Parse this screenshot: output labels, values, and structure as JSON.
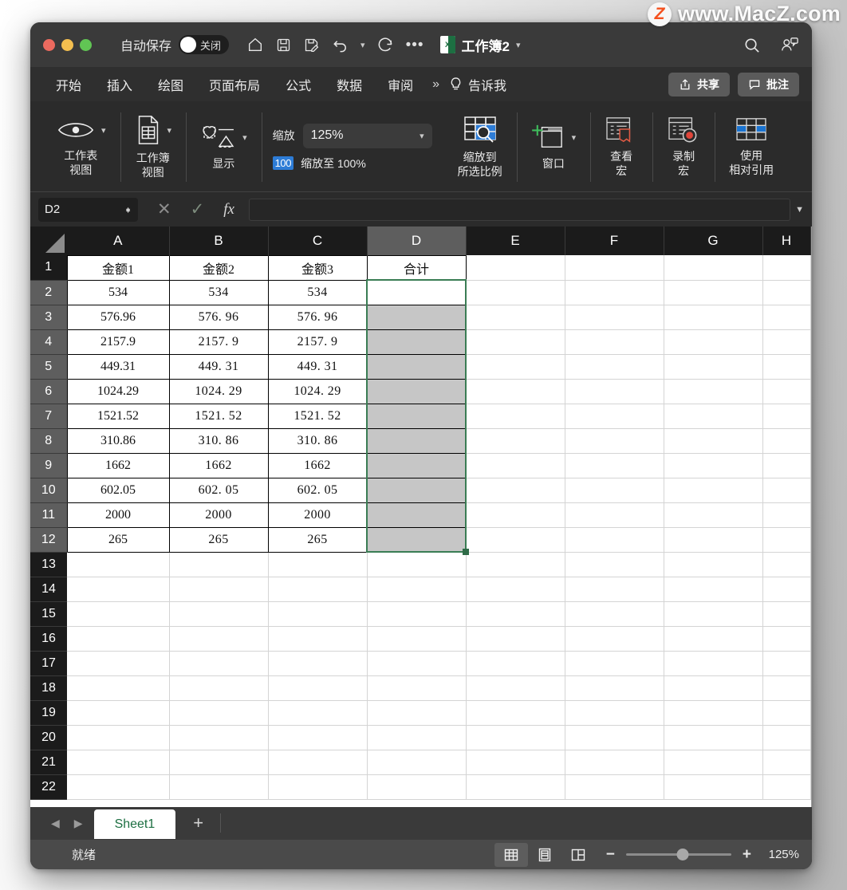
{
  "watermark": {
    "logo_letter": "Z",
    "text": "www.MacZ.com"
  },
  "titlebar": {
    "autosave_label": "自动保存",
    "autosave_state": "关闭",
    "icons": [
      "home-icon",
      "save-icon",
      "save-as-icon",
      "undo-icon",
      "redo-icon",
      "more-icon"
    ],
    "doc_title": "工作簿2",
    "badge_letter": "X",
    "search_icon": "search-icon",
    "collab_icon": "collaborators-icon"
  },
  "ribbon_tabs": {
    "items": [
      "开始",
      "插入",
      "绘图",
      "页面布局",
      "公式",
      "数据",
      "审阅"
    ],
    "overflow": "»",
    "tellme": "告诉我",
    "share_label": "共享",
    "comment_label": "批注"
  },
  "ribbon": {
    "groups": [
      {
        "label_line1": "工作表",
        "label_line2": "视图",
        "icon": "eye-icon"
      },
      {
        "label_line1": "工作簿",
        "label_line2": "视图",
        "icon": "workbook-page-icon"
      },
      {
        "label_line1": "显示",
        "label_line2": "",
        "icon": "show-shapes-icon"
      }
    ],
    "zoom": {
      "caption": "缩放",
      "value": "125%",
      "hundred_badge": "100",
      "zoom100_label": "缩放至 100%"
    },
    "zoom_selection": {
      "line1": "缩放到",
      "line2": "所选比例",
      "icon": "zoom-selection-icon"
    },
    "window": {
      "label": "窗口",
      "icon": "new-window-icon"
    },
    "macros": [
      {
        "line1": "查看",
        "line2": "宏",
        "icon": "view-macro-icon"
      },
      {
        "line1": "录制",
        "line2": "宏",
        "icon": "record-macro-icon"
      },
      {
        "line1": "使用",
        "line2": "相对引用",
        "icon": "relative-reference-icon"
      }
    ]
  },
  "formulabar": {
    "namebox_value": "D2",
    "cancel_icon": "cancel-icon",
    "confirm_icon": "confirm-icon",
    "fx_icon": "fx-icon",
    "formula_value": "",
    "expand_icon": "expand-formula-icon"
  },
  "grid": {
    "columns": [
      "A",
      "B",
      "C",
      "D",
      "E",
      "F",
      "G",
      "H"
    ],
    "selected_column": "D",
    "rows": [
      1,
      2,
      3,
      4,
      5,
      6,
      7,
      8,
      9,
      10,
      11,
      12,
      13,
      14,
      15,
      16,
      17,
      18,
      19,
      20,
      21,
      22
    ],
    "selected_rows": [
      2,
      3,
      4,
      5,
      6,
      7,
      8,
      9,
      10,
      11,
      12
    ],
    "headers": {
      "A": "金额1",
      "B": "金额2",
      "C": "金额3",
      "D": "合计"
    },
    "data": [
      {
        "row": 2,
        "a": "534",
        "b": "534",
        "c": "534"
      },
      {
        "row": 3,
        "a": "576.96",
        "b": "576. 96",
        "c": "576. 96"
      },
      {
        "row": 4,
        "a": "2157.9",
        "b": "2157. 9",
        "c": "2157. 9"
      },
      {
        "row": 5,
        "a": "449.31",
        "b": "449. 31",
        "c": "449. 31"
      },
      {
        "row": 6,
        "a": "1024.29",
        "b": "1024. 29",
        "c": "1024. 29"
      },
      {
        "row": 7,
        "a": "1521.52",
        "b": "1521. 52",
        "c": "1521. 52"
      },
      {
        "row": 8,
        "a": "310.86",
        "b": "310. 86",
        "c": "310. 86"
      },
      {
        "row": 9,
        "a": "1662",
        "b": "1662",
        "c": "1662"
      },
      {
        "row": 10,
        "a": "602.05",
        "b": "602. 05",
        "c": "602. 05"
      },
      {
        "row": 11,
        "a": "2000",
        "b": "2000",
        "c": "2000"
      },
      {
        "row": 12,
        "a": "265",
        "b": "265",
        "c": "265"
      }
    ],
    "active_cell": "D2",
    "selection_range": "D2:D12"
  },
  "sheetbar": {
    "prev_icon": "prev-sheet-icon",
    "next_icon": "next-sheet-icon",
    "tabs": [
      "Sheet1"
    ],
    "add_label": "+"
  },
  "statusbar": {
    "status": "就绪",
    "view_modes": [
      "normal-view-icon",
      "page-layout-icon",
      "page-break-icon"
    ],
    "active_view": 0,
    "zoom_out": "−",
    "zoom_in": "+",
    "zoom_percent": "125%"
  },
  "colors": {
    "accent_green": "#3a7d54",
    "sheet_tab_text": "#1d6f42",
    "selection_fill": "#c6c6c6",
    "badge_blue": "#2d7cd6"
  }
}
